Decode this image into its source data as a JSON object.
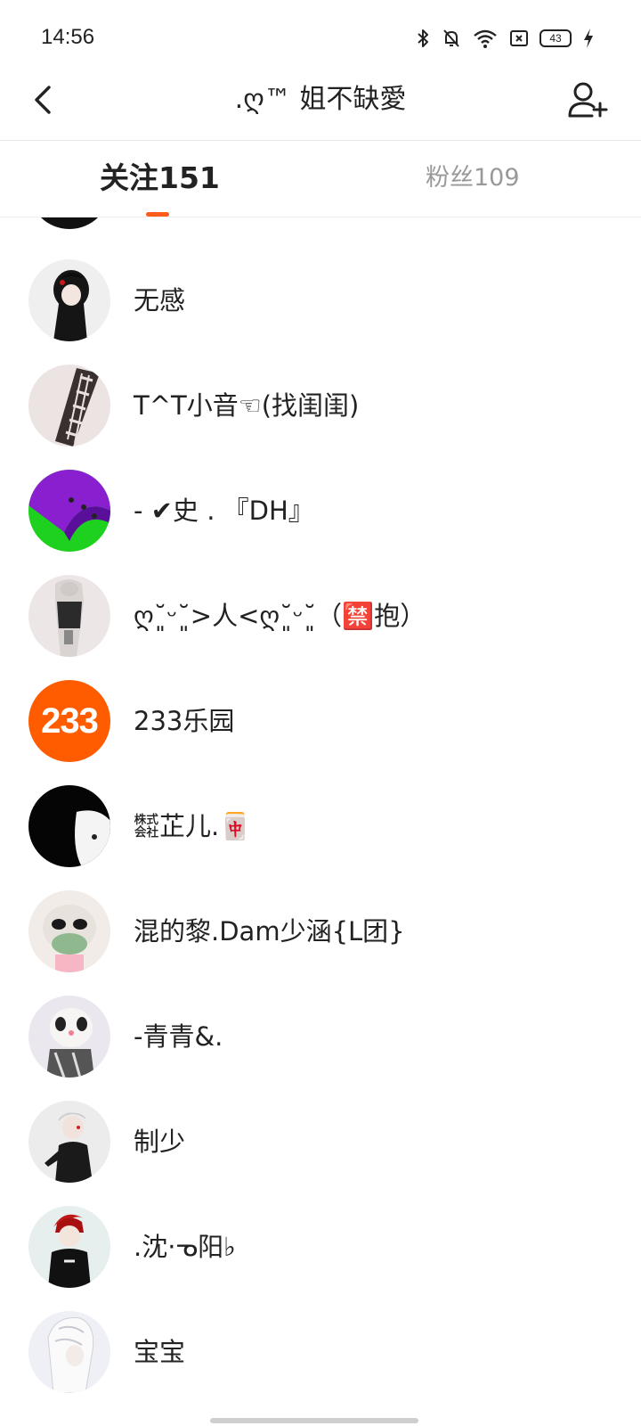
{
  "status_bar": {
    "time": "14:56",
    "battery": "43",
    "icons": [
      "bluetooth-icon",
      "mute-icon",
      "wifi-icon",
      "sim-icon",
      "battery-icon",
      "charging-icon"
    ]
  },
  "header": {
    "title": ".ღ™ 姐不缺愛",
    "back_icon": "chevron-left-icon",
    "add_user_icon": "add-user-icon"
  },
  "tabs": {
    "following": "关注151",
    "followers": "粉丝109",
    "active": "following",
    "accent_color": "#ff5b1a"
  },
  "following_list": [
    {
      "name": "无感"
    },
    {
      "name": "T^T小音☜(找闺闺)"
    },
    {
      "name": "-   ✔史 . 『DH』"
    },
    {
      "name": "ღ˘͈ᵕ˘͈>人<ღ˘͈ᵕ˘͈（🈲抱）"
    },
    {
      "name": "233乐园",
      "avatar_text": "233"
    },
    {
      "name": "㍿芷儿.🀄"
    },
    {
      "name": "混的黎.Dam少涵{L团}"
    },
    {
      "name": "-青青&."
    },
    {
      "name": "制少"
    },
    {
      "name": ".沈·ᓀ阳♭"
    },
    {
      "name": "宝宝"
    }
  ]
}
